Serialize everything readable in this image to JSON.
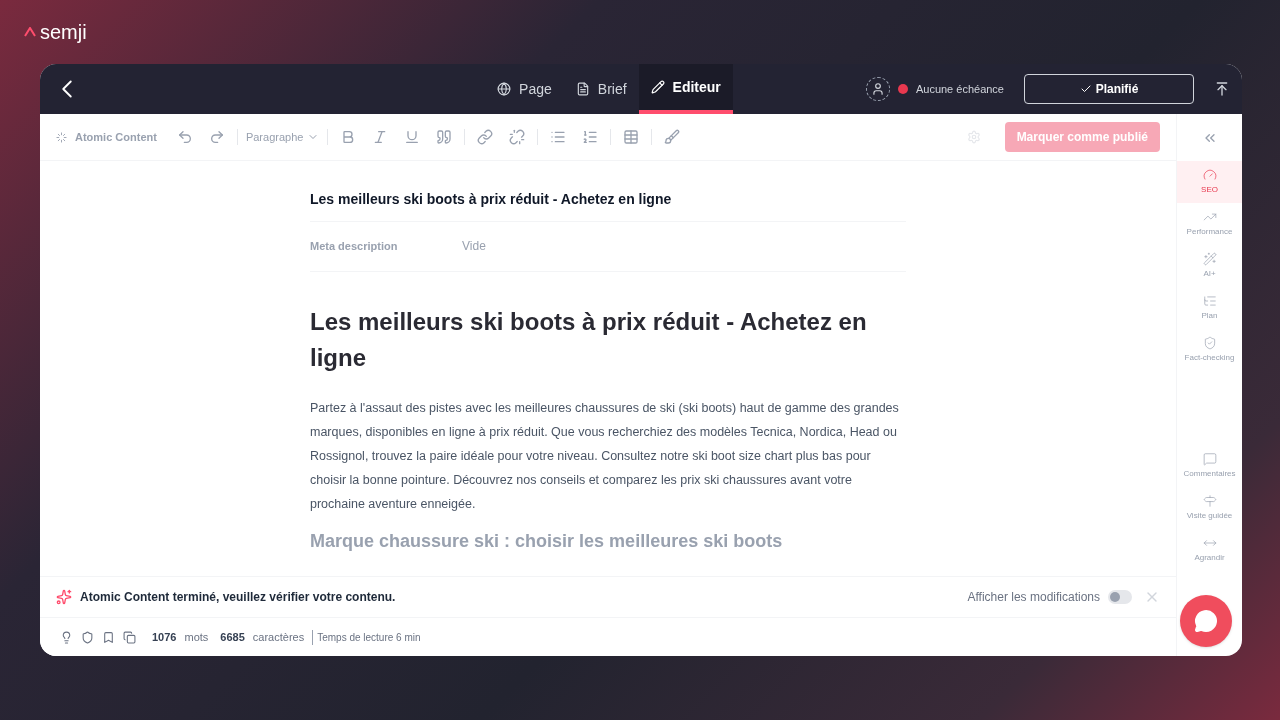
{
  "logo": {
    "text": "semji"
  },
  "header": {
    "tabs": [
      {
        "label": "Page",
        "selected": false
      },
      {
        "label": "Brief",
        "selected": false
      },
      {
        "label": "Editeur",
        "selected": true
      }
    ],
    "deadline": {
      "text": "Aucune échéance",
      "color": "#e8384f"
    },
    "status_button": "Planifié"
  },
  "toolbar": {
    "atomic": "Atomic Content",
    "format": "Paragraphe",
    "publish": "Marquer comme publié"
  },
  "document": {
    "meta_title": "Les meilleurs ski boots à prix réduit - Achetez en ligne",
    "meta_label": "Meta description",
    "meta_placeholder": "Vide",
    "h1": "Les meilleurs ski boots à prix réduit - Achetez en ligne",
    "paragraph": "Partez à l'assaut des pistes avec les meilleures chaussures de ski (ski boots) haut de gamme des grandes marques, disponibles en ligne à prix réduit. Que vous recherchiez des modèles Tecnica, Nordica, Head ou Rossignol, trouvez la paire idéale pour votre niveau. Consultez notre ski boot size chart plus bas pour choisir la bonne pointure. Découvrez nos conseils et comparez les prix ski chaussures avant votre prochaine aventure enneigée.",
    "h2": "Marque chaussure ski : choisir les meilleures ski boots"
  },
  "sidebar": {
    "items": [
      {
        "label": "SEO",
        "selected": true
      },
      {
        "label": "Performance",
        "selected": false
      },
      {
        "label": "AI+",
        "selected": false
      },
      {
        "label": "Plan",
        "selected": false
      },
      {
        "label": "Fact-checking",
        "selected": false
      }
    ],
    "bottom_items": [
      {
        "label": "Commentaires"
      },
      {
        "label": "Visite guidée"
      },
      {
        "label": "Agrandir"
      }
    ]
  },
  "notification": {
    "text": "Atomic Content terminé, veuillez vérifier votre contenu.",
    "toggle_label": "Afficher les modifications",
    "toggle_on": false
  },
  "status_bar": {
    "words": "1076",
    "words_label": "mots",
    "chars": "6685",
    "chars_label": "caractères",
    "reading": "Temps de lecture 6 min"
  }
}
